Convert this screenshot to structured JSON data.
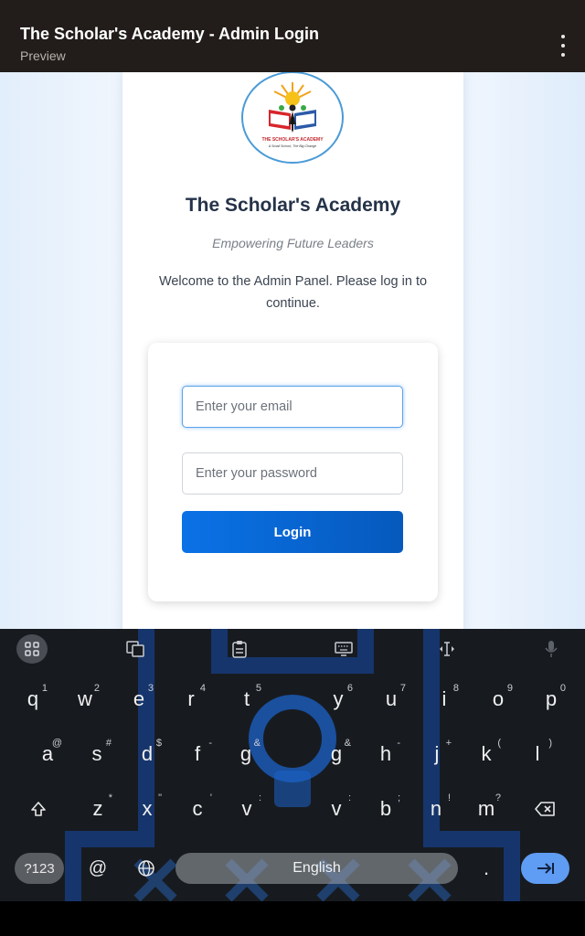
{
  "appbar": {
    "title": "The Scholar's Academy - Admin Login",
    "subtitle": "Preview",
    "menu_icon": "more-vertical-icon"
  },
  "page": {
    "logo_text": "THE SCHOLAR'S ACADEMY",
    "logo_motto": "A Small School, The Big Change",
    "school_name": "The Scholar's Academy",
    "tagline": "Empowering Future Leaders",
    "welcome": "Welcome to the Admin Panel. Please log in to continue.",
    "email_placeholder": "Enter your email",
    "password_placeholder": "Enter your password",
    "login_label": "Login",
    "colors": {
      "primary": "#0a72e6",
      "heading": "#253349",
      "focus": "#5da2e8"
    }
  },
  "keyboard": {
    "toolbar_icons": [
      "apps-grid-icon",
      "translate-icon",
      "clipboard-icon",
      "keyboard-icon",
      "text-cursor-icon",
      "microphone-icon"
    ],
    "rows": [
      [
        [
          "q",
          "1"
        ],
        [
          "w",
          "2"
        ],
        [
          "e",
          "3"
        ],
        [
          "r",
          "4"
        ],
        [
          "t",
          "5"
        ],
        [
          "y",
          "6"
        ],
        [
          "u",
          "7"
        ],
        [
          "i",
          "8"
        ],
        [
          "o",
          "9"
        ],
        [
          "p",
          "0"
        ]
      ],
      [
        [
          "a",
          "@"
        ],
        [
          "s",
          "#"
        ],
        [
          "d",
          "$"
        ],
        [
          "f",
          "-"
        ],
        [
          "g",
          "&"
        ],
        [
          "g",
          "&"
        ],
        [
          "h",
          "-"
        ],
        [
          "j",
          "+"
        ],
        [
          "k",
          "("
        ],
        [
          "l",
          ")"
        ]
      ],
      [
        [
          "z",
          "*"
        ],
        [
          "x",
          "\""
        ],
        [
          "c",
          "'"
        ],
        [
          "v",
          ":"
        ],
        [
          "v",
          ":"
        ],
        [
          "b",
          ";"
        ],
        [
          "n",
          "!"
        ],
        [
          "m",
          "?"
        ]
      ]
    ],
    "symbols_label": "?123",
    "at_label": "@",
    "space_label": "English",
    "period_label": "."
  }
}
